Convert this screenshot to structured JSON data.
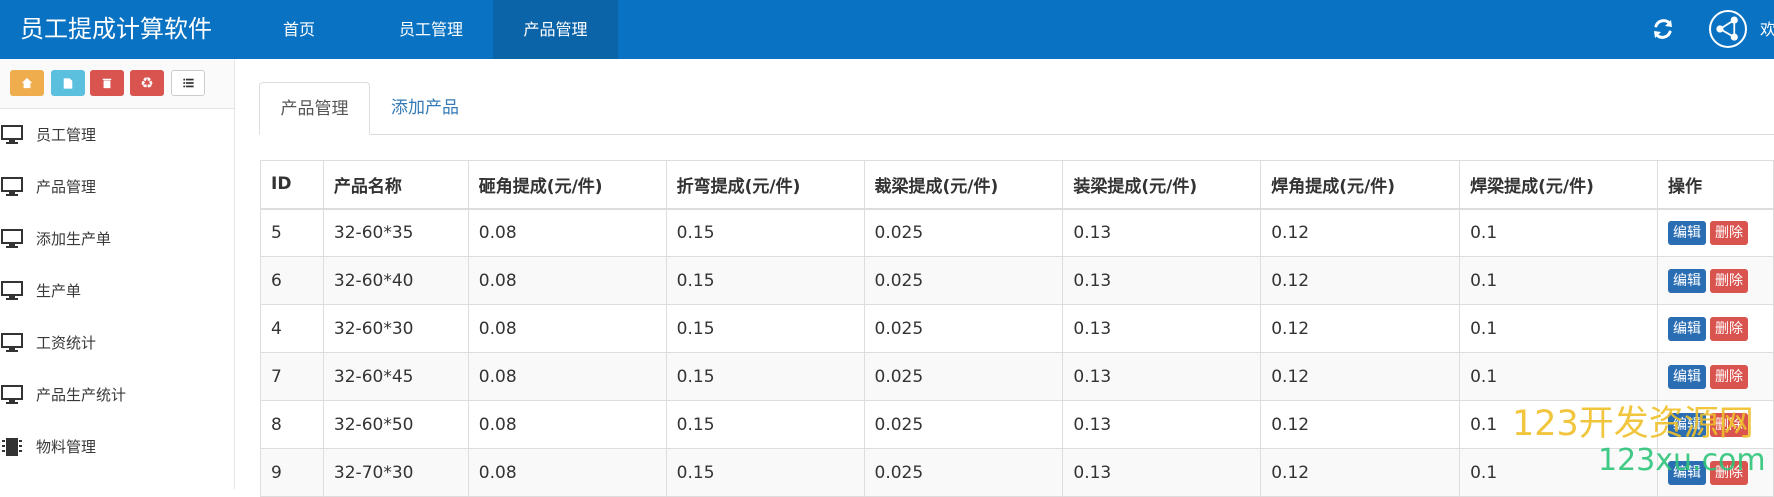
{
  "app": {
    "title": "员工提成计算软件",
    "welcome": "欢"
  },
  "nav": [
    {
      "label": "首页",
      "active": false
    },
    {
      "label": "员工管理",
      "active": false
    },
    {
      "label": "产品管理",
      "active": true
    }
  ],
  "shortcuts": [
    {
      "icon": "home-icon",
      "color": "#f0ad4e"
    },
    {
      "icon": "file-icon",
      "color": "#5bc0de"
    },
    {
      "icon": "trash-icon",
      "color": "#d9534f"
    },
    {
      "icon": "recycle-icon",
      "color": "#d9534f"
    },
    {
      "icon": "list-icon",
      "color": "#ffffff"
    }
  ],
  "sidebar": {
    "items": [
      {
        "label": "员工管理",
        "icon": "monitor-icon"
      },
      {
        "label": "产品管理",
        "icon": "monitor-icon"
      },
      {
        "label": "添加生产单",
        "icon": "monitor-icon"
      },
      {
        "label": "生产单",
        "icon": "monitor-icon"
      },
      {
        "label": "工资统计",
        "icon": "monitor-icon"
      },
      {
        "label": "产品生产统计",
        "icon": "monitor-icon"
      },
      {
        "label": "物料管理",
        "icon": "chip-icon"
      }
    ]
  },
  "tabs": [
    {
      "label": "产品管理",
      "active": true
    },
    {
      "label": "添加产品",
      "active": false
    }
  ],
  "table": {
    "headers": [
      "ID",
      "产品名称",
      "砸角提成(元/件)",
      "折弯提成(元/件)",
      "裁梁提成(元/件)",
      "装梁提成(元/件)",
      "焊角提成(元/件)",
      "焊梁提成(元/件)",
      "操作"
    ],
    "edit_label": "编辑",
    "delete_label": "删除",
    "rows": [
      [
        "5",
        "32-60*35",
        "0.08",
        "0.15",
        "0.025",
        "0.13",
        "0.12",
        "0.1"
      ],
      [
        "6",
        "32-60*40",
        "0.08",
        "0.15",
        "0.025",
        "0.13",
        "0.12",
        "0.1"
      ],
      [
        "4",
        "32-60*30",
        "0.08",
        "0.15",
        "0.025",
        "0.13",
        "0.12",
        "0.1"
      ],
      [
        "7",
        "32-60*45",
        "0.08",
        "0.15",
        "0.025",
        "0.13",
        "0.12",
        "0.1"
      ],
      [
        "8",
        "32-60*50",
        "0.08",
        "0.15",
        "0.025",
        "0.13",
        "0.12",
        "0.1"
      ],
      [
        "9",
        "32-70*30",
        "0.08",
        "0.15",
        "0.025",
        "0.13",
        "0.12",
        "0.1"
      ]
    ]
  },
  "watermark": {
    "line1": "123开发资源网",
    "line2": "123xu.com"
  }
}
